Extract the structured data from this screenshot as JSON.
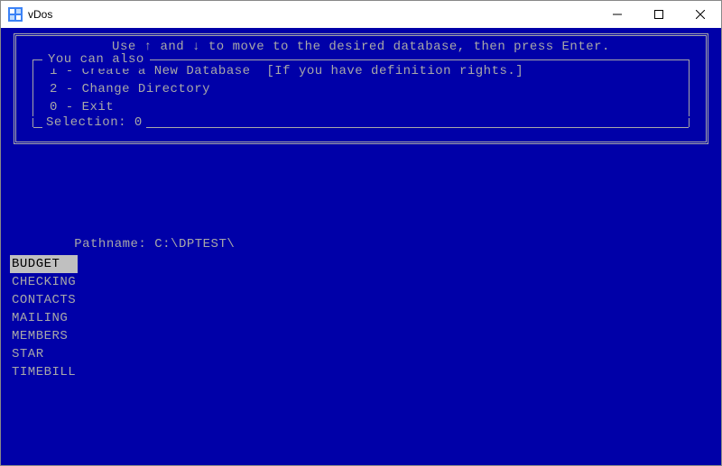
{
  "window": {
    "title": "vDos"
  },
  "instruction": "Use ↑ and ↓ to move to the desired database, then press Enter.",
  "group": {
    "legend": "You can also",
    "opt1": "1 - Create a New Database  [If you have definition rights.]",
    "opt2": "2 - Change Directory",
    "opt0": "0 - Exit"
  },
  "selection": {
    "label": "Selection:  ",
    "value": "0"
  },
  "pathname": {
    "label": "Pathname: ",
    "value": "C:\\DPTEST\\"
  },
  "databases": [
    "BUDGET  ",
    "CHECKING",
    "CONTACTS",
    "MAILING",
    "MEMBERS",
    "STAR",
    "TIMEBILL"
  ],
  "selected_index": 0
}
